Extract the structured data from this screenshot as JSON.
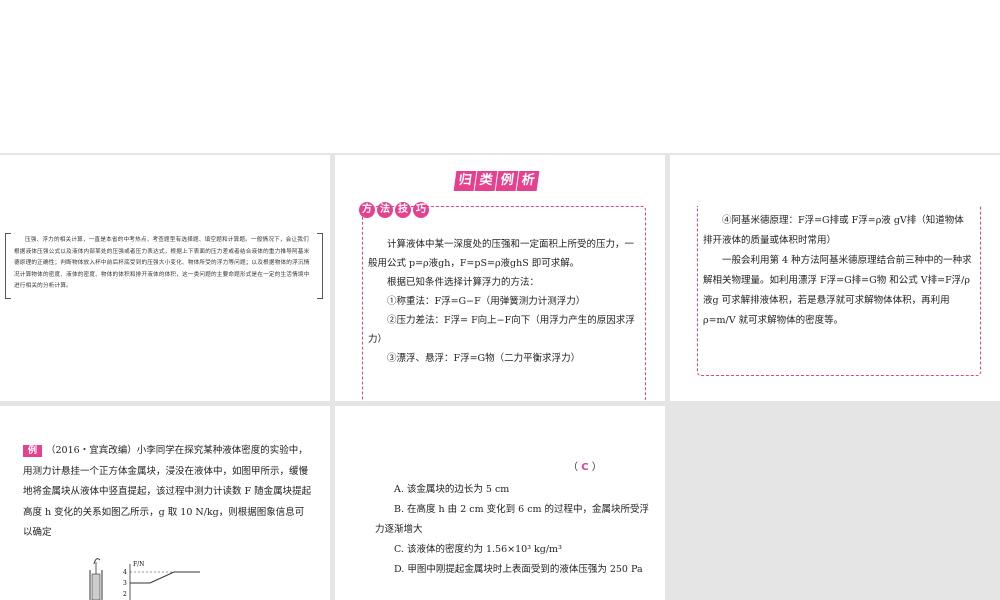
{
  "slide1": {
    "intro": "压强、浮力的相关计算，一直是本省的中考热点，考查题型有选择题、填空题和计算题。一般情况下，会让我们根据液体压强公式以及液体内部某处的压强或者压力表达式，根据上下表面的压力差或者结合液体的重力推导阿基米德原理的正确性；判断物体放入杯中前后杯底受到的压强大小变化、物体所受的浮力等问题；以及根据物体的浮沉情况计算物体的密度、液体的密度、物体的体积和排开液体的体积，这一类问题的主要命题形式是在一定的生活情境中进行相关的分析计算。"
  },
  "slide2": {
    "banner": [
      "归",
      "类",
      "例",
      "析"
    ],
    "method_tag": [
      "方",
      "法",
      "技",
      "巧"
    ],
    "p1": "计算液体中某一深度处的压强和一定面积上所受的压力，一般用公式 p=ρ液gh，F=pS=ρ液ghS 即可求解。",
    "p2": "根据已知条件选择计算浮力的方法：",
    "p3": "①称重法：F浮=G−F（用弹簧测力计测浮力）",
    "p4": "②压力差法：F浮= F向上−F向下（用浮力产生的原因求浮力）",
    "p5": "③漂浮、悬浮：F浮=G物（二力平衡求浮力）"
  },
  "slide3": {
    "p1": "④阿基米德原理：F浮=G排或 F浮=ρ液 gV排（知道物体排开液体的质量或体积时常用）",
    "p2": "一般会利用第 4 种方法阿基米德原理结合前三种中的一种求解相关物理量。如利用漂浮 F浮=G排=G物 和公式 V排=F浮/ρ液g 可求解排液体积，若是悬浮就可求解物体体积，再利用 ρ=m/V 就可求解物体的密度等。"
  },
  "slide4": {
    "tag": "例",
    "source": "（2016・宜宾改编）",
    "text": "小李同学在探究某种液体密度的实验中，用测力计悬挂一个正方体金属块，浸没在液体中，如图甲所示，缓慢地将金属块从液体中竖直提起，该过程中测力计读数 F 随金属块提起高度 h 变化的关系如图乙所示，g 取 10 N/kg，则根据图象信息可以确定",
    "fig_ylabel": "F/N",
    "fig_ticks": [
      "4",
      "3",
      "2"
    ]
  },
  "slide5": {
    "answer_open": "（",
    "answer": "C",
    "answer_close": "）",
    "choices": [
      "A. 该金属块的边长为 5 cm",
      "B. 在高度 h 由 2 cm 变化到 6 cm 的过程中，金属块所受浮力逐渐增大",
      "C. 该液体的密度约为 1.56×10³ kg/m³",
      "D. 甲图中刚提起金属块时上表面受到的液体压强为 250 Pa"
    ]
  }
}
